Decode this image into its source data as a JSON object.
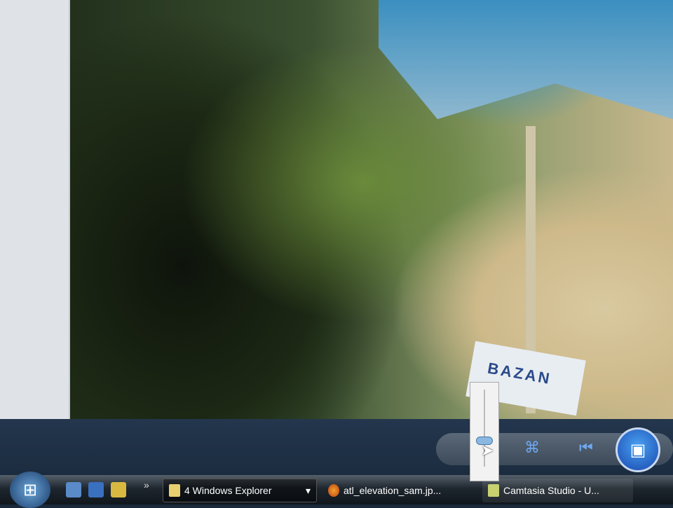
{
  "photo": {
    "sign_text": "BAZAN"
  },
  "controls": {
    "zoom_icon": "magnifier-icon",
    "actual_size_icon": "actual-size-icon",
    "previous_icon": "previous-icon",
    "slideshow_icon": "slideshow-icon"
  },
  "taskbar": {
    "overflow": "»",
    "tasks": [
      {
        "label": "4 Windows Explorer",
        "icon": "folder-icon",
        "dropdown": "▾"
      },
      {
        "label": "atl_elevation_sam.jp...",
        "icon": "firefox-icon"
      },
      {
        "label": "Camtasia Studio - U...",
        "icon": "camtasia-icon"
      }
    ]
  }
}
